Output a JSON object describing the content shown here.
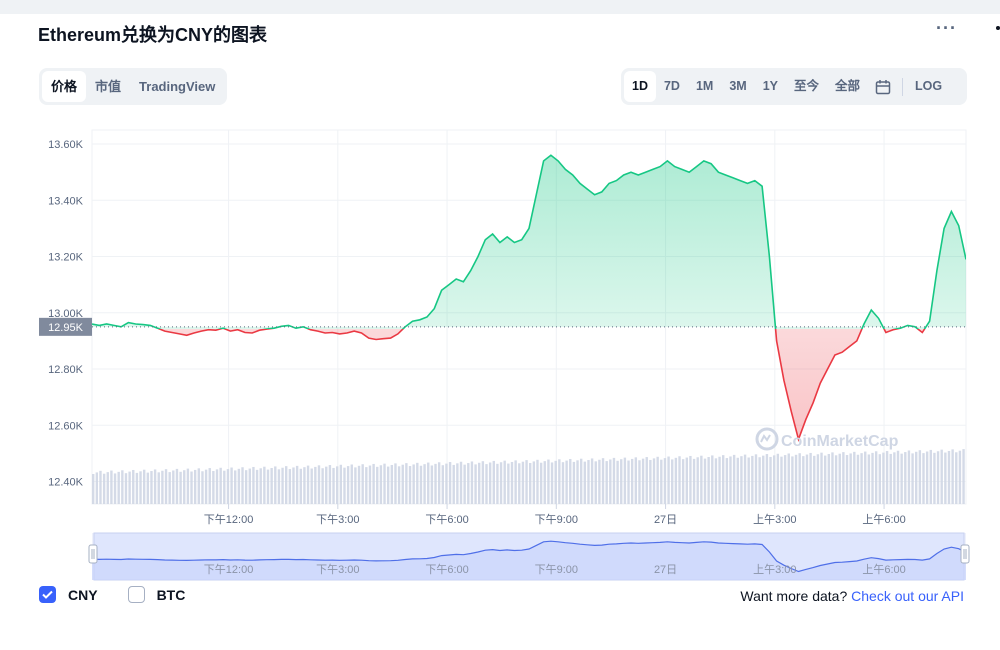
{
  "title": "Ethereum兑换为CNY的图表",
  "menu_icon": "more-dots-icon",
  "tabs_left": [
    {
      "label": "价格",
      "active": true
    },
    {
      "label": "市值",
      "active": false
    },
    {
      "label": "TradingView",
      "active": false
    }
  ],
  "tabs_right": [
    {
      "label": "1D",
      "active": true
    },
    {
      "label": "7D",
      "active": false
    },
    {
      "label": "1M",
      "active": false
    },
    {
      "label": "3M",
      "active": false
    },
    {
      "label": "1Y",
      "active": false
    },
    {
      "label": "至今",
      "active": false
    },
    {
      "label": "全部",
      "active": false
    }
  ],
  "calendar_icon": "calendar-icon",
  "log_label": "LOG",
  "legend": [
    {
      "label": "CNY",
      "checked": true
    },
    {
      "label": "BTC",
      "checked": false
    }
  ],
  "footer": {
    "text": "Want more data?",
    "link": "Check out our API"
  },
  "watermark": "CoinMarketCap",
  "colors": {
    "up": "#16c784",
    "down": "#ea3943",
    "accent": "#3861fb",
    "navigator": "#4f6fe8"
  },
  "chart_data": {
    "type": "line",
    "ylim": [
      12320,
      13650
    ],
    "yticks": [
      12400,
      12600,
      12800,
      13000,
      13200,
      13400,
      13600
    ],
    "ytick_labels": [
      "12.40K",
      "12.60K",
      "12.80K",
      "13.00K",
      "13.20K",
      "13.40K",
      "13.60K"
    ],
    "xtick_labels": [
      "下午12:00",
      "下午3:00",
      "下午6:00",
      "下午9:00",
      "27日",
      "上午3:00",
      "上午6:00"
    ],
    "xticks_hours": [
      3.75,
      6.75,
      9.75,
      12.75,
      15.75,
      18.75,
      21.75
    ],
    "baseline": 12950,
    "baseline_label": "12.95K",
    "x_hours": [
      0,
      0.2,
      0.4,
      0.6,
      0.8,
      1.0,
      1.2,
      1.4,
      1.6,
      1.8,
      2.0,
      2.2,
      2.4,
      2.6,
      2.8,
      3.0,
      3.2,
      3.4,
      3.6,
      3.8,
      4.0,
      4.2,
      4.4,
      4.6,
      4.8,
      5.0,
      5.2,
      5.4,
      5.6,
      5.8,
      6.0,
      6.2,
      6.4,
      6.6,
      6.8,
      7.0,
      7.2,
      7.4,
      7.6,
      7.8,
      8.0,
      8.2,
      8.4,
      8.6,
      8.8,
      9.0,
      9.2,
      9.4,
      9.6,
      9.8,
      10.0,
      10.2,
      10.4,
      10.6,
      10.8,
      11.0,
      11.2,
      11.4,
      11.6,
      11.8,
      12.0,
      12.2,
      12.4,
      12.6,
      12.8,
      13.0,
      13.2,
      13.4,
      13.6,
      13.8,
      14.0,
      14.2,
      14.4,
      14.6,
      14.8,
      15.0,
      15.2,
      15.4,
      15.6,
      15.8,
      16.0,
      16.2,
      16.4,
      16.6,
      16.8,
      17.0,
      17.2,
      17.4,
      17.6,
      17.8,
      18.0,
      18.2,
      18.4,
      18.6,
      18.8,
      19.0,
      19.2,
      19.4,
      19.6,
      19.8,
      20.0,
      20.2,
      20.4,
      20.6,
      20.8,
      21.0,
      21.2,
      21.4,
      21.6,
      21.8,
      22.0,
      22.2,
      22.4,
      22.6,
      22.8,
      23.0,
      23.2,
      23.4,
      23.6,
      23.8,
      24.0
    ],
    "values": [
      12960,
      12955,
      12960,
      12955,
      12950,
      12965,
      12960,
      12958,
      12955,
      12945,
      12935,
      12930,
      12925,
      12920,
      12928,
      12935,
      12940,
      12938,
      12945,
      12935,
      12940,
      12930,
      12928,
      12938,
      12942,
      12945,
      12952,
      12955,
      12945,
      12950,
      12940,
      12935,
      12928,
      12930,
      12925,
      12928,
      12935,
      12928,
      12910,
      12905,
      12908,
      12910,
      12925,
      12950,
      12970,
      12975,
      12985,
      13015,
      13080,
      13100,
      13120,
      13110,
      13150,
      13200,
      13260,
      13280,
      13250,
      13270,
      13250,
      13260,
      13300,
      13420,
      13540,
      13560,
      13540,
      13510,
      13490,
      13460,
      13440,
      13420,
      13430,
      13460,
      13470,
      13490,
      13500,
      13490,
      13500,
      13510,
      13520,
      13540,
      13520,
      13510,
      13500,
      13520,
      13540,
      13530,
      13500,
      13490,
      13480,
      13470,
      13460,
      13470,
      13450,
      13200,
      12900,
      12760,
      12650,
      12550,
      12620,
      12680,
      12750,
      12800,
      12850,
      12860,
      12880,
      12900,
      12960,
      13010,
      12980,
      12930,
      12940,
      12945,
      12955,
      12950,
      12930,
      12970,
      13150,
      13300,
      13360,
      13310,
      13190
    ],
    "volume_hint": "bars",
    "navigator_ticks": [
      "下午12:00",
      "下午3:00",
      "下午6:00",
      "下午9:00",
      "27日",
      "上午3:00",
      "上午6:00"
    ]
  }
}
